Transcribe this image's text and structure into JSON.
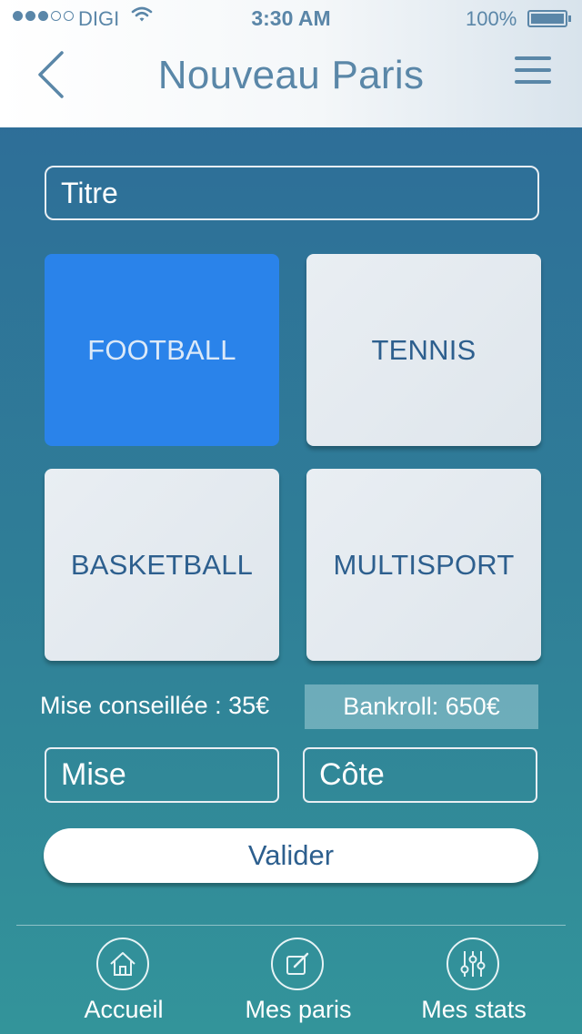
{
  "status_bar": {
    "carrier": "DIGI",
    "time": "3:30 AM",
    "battery": "100%"
  },
  "nav": {
    "title": "Nouveau Paris",
    "back_icon": "chevron-left-icon",
    "menu_icon": "hamburger-menu-icon"
  },
  "form": {
    "title_placeholder": "Titre",
    "sports": [
      {
        "label": "FOOTBALL",
        "selected": true
      },
      {
        "label": "TENNIS",
        "selected": false
      },
      {
        "label": "BASKETBALL",
        "selected": false
      },
      {
        "label": "MULTISPORT",
        "selected": false
      }
    ],
    "mise_conseillee": "Mise conseillée : 35€",
    "bankroll": "Bankroll: 650€",
    "mise_placeholder": "Mise",
    "cote_placeholder": "Côte",
    "submit_label": "Valider"
  },
  "tabbar": {
    "items": [
      {
        "label": "Accueil",
        "icon": "home-icon"
      },
      {
        "label": "Mes paris",
        "icon": "edit-icon"
      },
      {
        "label": "Mes stats",
        "icon": "sliders-icon"
      }
    ]
  },
  "colors": {
    "accent": "#2a83ea",
    "header_text": "#5a87a8",
    "tile_text": "#2d5f8e"
  }
}
